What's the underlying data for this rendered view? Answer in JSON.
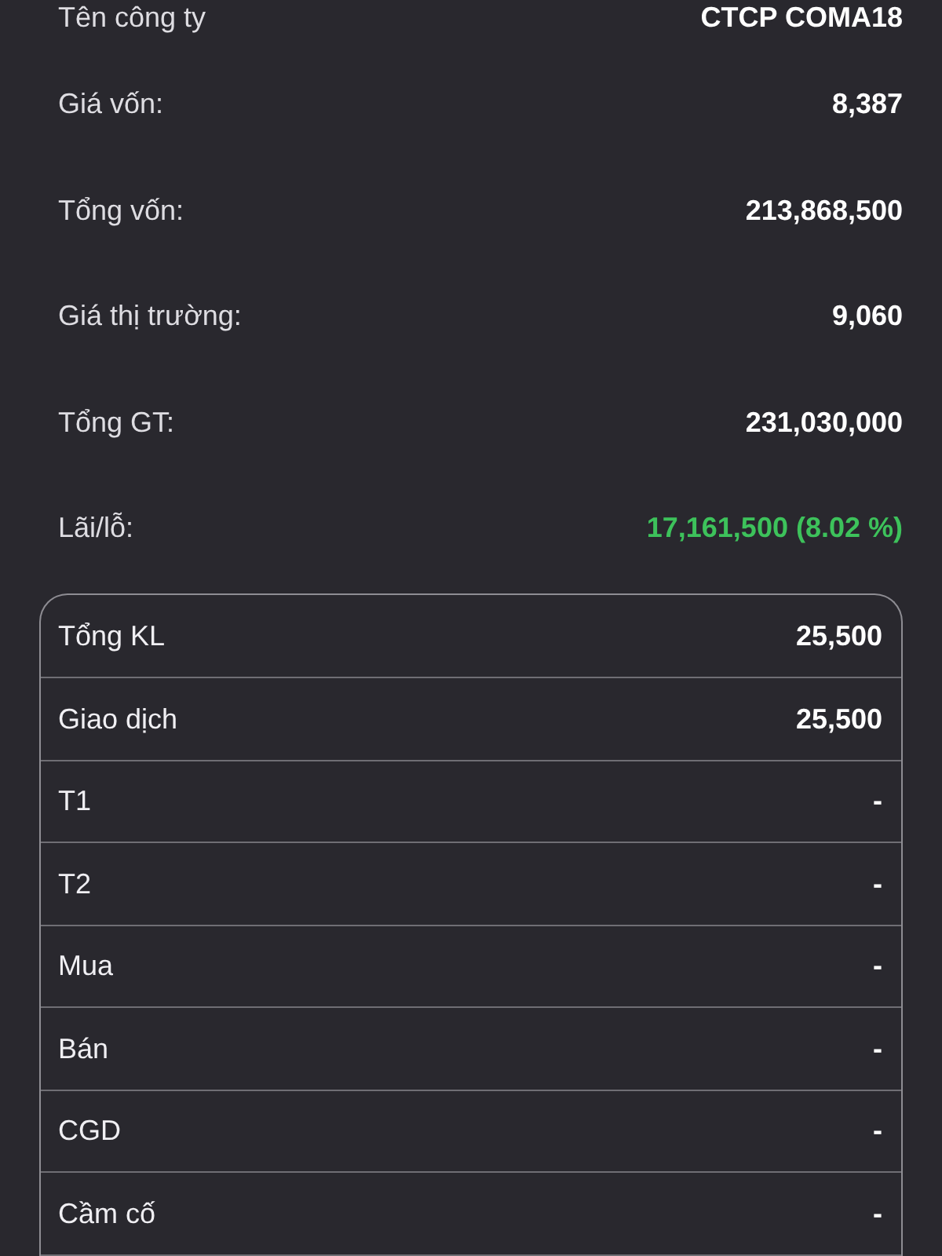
{
  "summary": [
    {
      "label": "Tên công ty",
      "value": "CTCP COMA18",
      "kind": "plain"
    },
    {
      "label": "Giá vốn:",
      "value": "8,387",
      "kind": "plain"
    },
    {
      "label": "Tổng vốn:",
      "value": "213,868,500",
      "kind": "plain"
    },
    {
      "label": "Giá thị trường:",
      "value": "9,060",
      "kind": "plain"
    },
    {
      "label": "Tổng GT:",
      "value": "231,030,000",
      "kind": "plain"
    },
    {
      "label": "Lãi/lỗ:",
      "value": "17,161,500 (8.02 %)",
      "kind": "gain"
    }
  ],
  "table": {
    "rows": [
      {
        "label": "Tổng KL",
        "value": "25,500"
      },
      {
        "label": "Giao dịch",
        "value": "25,500"
      },
      {
        "label": "T1",
        "value": "-"
      },
      {
        "label": "T2",
        "value": "-"
      },
      {
        "label": "Mua",
        "value": "-"
      },
      {
        "label": "Bán",
        "value": "-"
      },
      {
        "label": "CGD",
        "value": "-"
      },
      {
        "label": "Cầm cố",
        "value": "-"
      }
    ]
  }
}
